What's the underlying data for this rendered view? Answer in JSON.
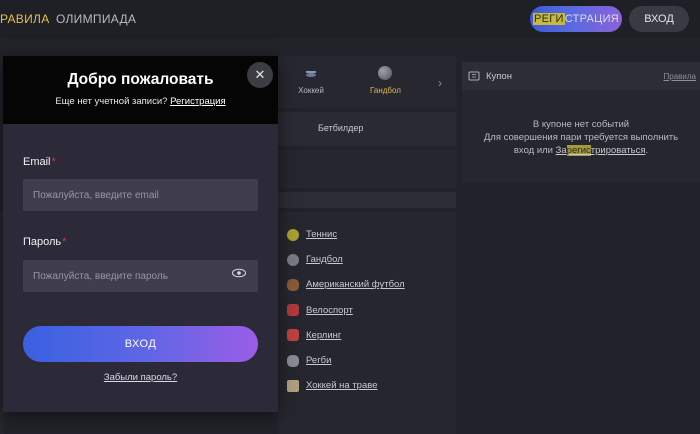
{
  "header": {
    "nav": [
      "РАВИЛА",
      "ОЛИМПИАДА"
    ],
    "register_label_highlight": "РЕГИ",
    "register_label_rest": "СТРАЦИЯ",
    "login_label": "ВХОД"
  },
  "sports_strip": {
    "items": [
      {
        "label": "Хоккей",
        "icon": "hockey-icon"
      },
      {
        "label": "Гандбол",
        "icon": "handball-icon",
        "active": true
      }
    ],
    "next_icon": "chevron-right-icon"
  },
  "betbuilder_label": "Бетбилдер",
  "sport_list": [
    {
      "label": "Теннис",
      "color": "#a8a030"
    },
    {
      "label": "Гандбол",
      "color": "#7a7a82"
    },
    {
      "label": "Американский футбол",
      "color": "#8a5a38"
    },
    {
      "label": "Велоспорт",
      "color": "#b03a3a"
    },
    {
      "label": "Керлинг",
      "color": "#c04040"
    },
    {
      "label": "Регби",
      "color": "#8a8a92"
    },
    {
      "label": "Хоккей на траве",
      "color": "#b0a080"
    }
  ],
  "coupon": {
    "title": "Купон",
    "rules_link": "Правила",
    "line1": "В купоне нет событий",
    "line2": "Для совершения пари требуется выполнить",
    "line3_prefix": "вход или ",
    "link_part1": "За",
    "link_highlight": "регис",
    "link_part2": "трироваться",
    "line3_suffix": "."
  },
  "modal": {
    "title": "Добро пожаловать",
    "subtitle": "Еще нет учетной записи?",
    "register_link": "Регистрация",
    "close_icon": "close-icon",
    "email_label": "Email",
    "email_placeholder": "Пожалуйста, введите email",
    "email_value": "",
    "password_label": "Пароль",
    "password_placeholder": "Пожалуйста, введите пароль",
    "password_value": "",
    "required_mark": "*",
    "login_button": "ВХОД",
    "forgot_link": "Забыли пароль?"
  }
}
